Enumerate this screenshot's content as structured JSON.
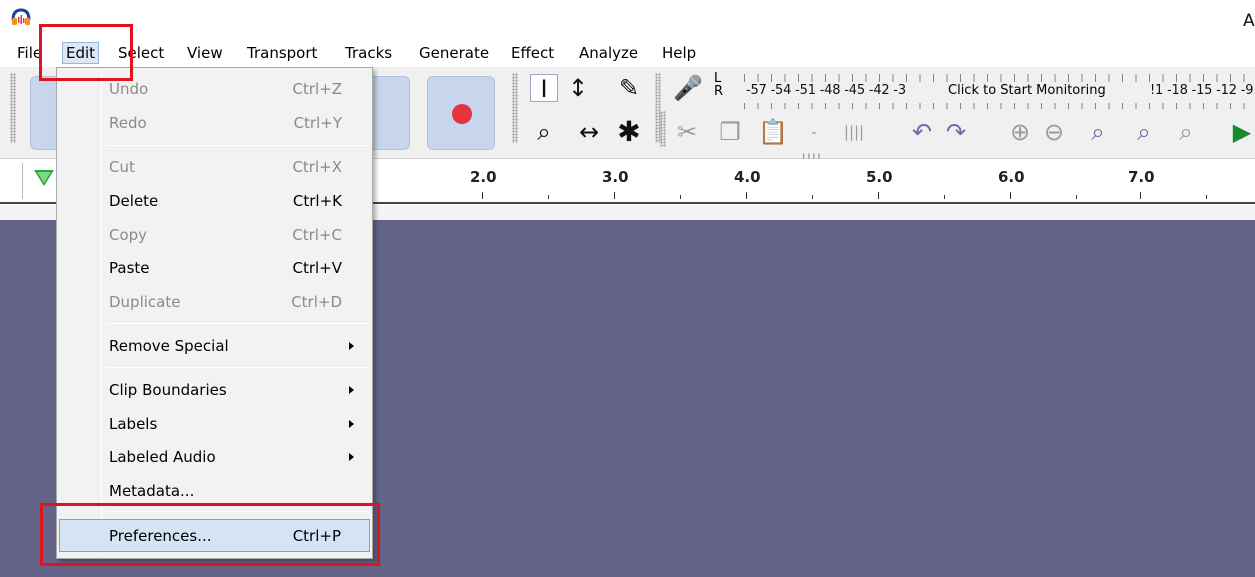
{
  "app": {
    "title_fragment": "A",
    "accent_highlight": "#e0131f"
  },
  "menubar": {
    "items": [
      "File",
      "Edit",
      "Select",
      "View",
      "Transport",
      "Tracks",
      "Generate",
      "Effect",
      "Analyze",
      "Help"
    ],
    "open_menu": "Edit"
  },
  "toolbar": {
    "meter_left": "L",
    "meter_right": "R",
    "meter_scale_left": "-57 -54 -51 -48 -45 -42 -3",
    "monitor_prompt": "Click to Start Monitoring",
    "meter_scale_right": "!1 -18 -15 -12 -9",
    "icons": [
      "selection-tool-icon",
      "envelope-tool-icon",
      "draw-tool-icon",
      "microphone-icon",
      "zoom-tool-icon",
      "timeshift-tool-icon",
      "multi-tool-icon",
      "cut-icon",
      "copy-icon",
      "paste-icon",
      "trim-audio-icon",
      "silence-audio-icon",
      "undo-icon",
      "redo-icon",
      "zoom-in-icon",
      "zoom-out-icon",
      "fit-selection-icon",
      "fit-project-icon",
      "zoom-toggle-icon",
      "play-at-speed-icon"
    ]
  },
  "ruler": {
    "labels": [
      "2.0",
      "3.0",
      "4.0",
      "5.0",
      "6.0",
      "7.0"
    ]
  },
  "edit_menu": {
    "items": [
      {
        "label": "Undo",
        "accel": "Ctrl+Z",
        "disabled": true
      },
      {
        "label": "Redo",
        "accel": "Ctrl+Y",
        "disabled": true
      },
      {
        "label": "Cut",
        "accel": "Ctrl+X",
        "disabled": true
      },
      {
        "label": "Delete",
        "accel": "Ctrl+K",
        "disabled": false
      },
      {
        "label": "Copy",
        "accel": "Ctrl+C",
        "disabled": true
      },
      {
        "label": "Paste",
        "accel": "Ctrl+V",
        "disabled": false
      },
      {
        "label": "Duplicate",
        "accel": "Ctrl+D",
        "disabled": true
      },
      {
        "label": "Remove Special",
        "accel": "",
        "submenu": true
      },
      {
        "label": "Clip Boundaries",
        "accel": "",
        "submenu": true
      },
      {
        "label": "Labels",
        "accel": "",
        "submenu": true
      },
      {
        "label": "Labeled Audio",
        "accel": "",
        "submenu": true
      },
      {
        "label": "Metadata...",
        "accel": ""
      },
      {
        "label": "Preferences...",
        "accel": "Ctrl+P",
        "highlighted": true
      }
    ]
  }
}
